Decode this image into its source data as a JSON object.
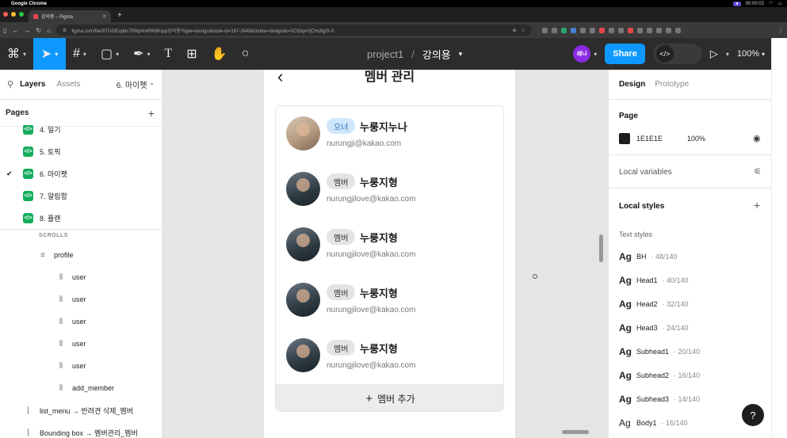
{
  "macbar": {
    "app": "Google Chrome",
    "recording_time": "00:00:02"
  },
  "browser": {
    "tab_title": "강의용 – Figma",
    "url": "figma.com/file/9TGGEup6s7P8qHmPtN8Kqq/강의용?type=design&node-id=167-2648&mode=design&t=XCtDqvVjCHs9gfX-0"
  },
  "toolbar": {
    "project": "project1",
    "separator": "/",
    "file": "강의용",
    "user_initials": "레나",
    "share_label": "Share",
    "zoom": "100%"
  },
  "left": {
    "tab_layers": "Layers",
    "tab_assets": "Assets",
    "current_page": "6. 마이펫",
    "pages_title": "Pages",
    "pages": [
      {
        "label": "4. 일기",
        "checked": false
      },
      {
        "label": "5. 토픽",
        "checked": false
      },
      {
        "label": "6. 마이펫",
        "checked": true
      },
      {
        "label": "7. 알림함",
        "checked": false
      },
      {
        "label": "8. 플랜",
        "checked": false
      }
    ],
    "scrolls_label": "SCROLLS",
    "layers": [
      {
        "label": "profile",
        "icon": "list-icon"
      },
      {
        "label": "user",
        "icon": "component-bars-icon"
      },
      {
        "label": "user",
        "icon": "component-bars-icon"
      },
      {
        "label": "user",
        "icon": "component-bars-icon"
      },
      {
        "label": "user",
        "icon": "component-bars-icon"
      },
      {
        "label": "user",
        "icon": "component-bars-icon"
      },
      {
        "label": "add_member",
        "icon": "component-bars-icon"
      },
      {
        "label": "list_menu → 반려견 삭제_멤버",
        "icon": "instance-icon"
      },
      {
        "label": "Bounding box → 멤버관리_멤버",
        "icon": "instance-icon"
      }
    ]
  },
  "canvas": {
    "title": "멤버 관리",
    "members": [
      {
        "role": "오너",
        "role_type": "owner",
        "name": "누룽지누나",
        "email": "nurungji@kakao.com"
      },
      {
        "role": "멤버",
        "role_type": "member",
        "name": "누룽지형",
        "email": "nurungjilove@kakao.com"
      },
      {
        "role": "멤버",
        "role_type": "member",
        "name": "누룽지형",
        "email": "nurungjilove@kakao.com"
      },
      {
        "role": "멤버",
        "role_type": "member",
        "name": "누룽지형",
        "email": "nurungjilove@kakao.com"
      },
      {
        "role": "멤버",
        "role_type": "member",
        "name": "누룽지형",
        "email": "nurungjilove@kakao.com"
      }
    ],
    "add_label": "멤버 추가"
  },
  "right": {
    "tab_design": "Design",
    "tab_prototype": "Prototype",
    "page_title": "Page",
    "bg_hex": "1E1E1E",
    "bg_opacity": "100%",
    "local_variables": "Local variables",
    "local_styles": "Local styles",
    "text_styles_label": "Text styles",
    "text_styles": [
      {
        "name": "BH",
        "meta": "48/140"
      },
      {
        "name": "Head1",
        "meta": "40/140"
      },
      {
        "name": "Head2",
        "meta": "32/140"
      },
      {
        "name": "Head3",
        "meta": "24/140"
      },
      {
        "name": "Subhead1",
        "meta": "20/140"
      },
      {
        "name": "Subhead2",
        "meta": "16/140"
      },
      {
        "name": "Subhead3",
        "meta": "14/140"
      },
      {
        "name": "Body1",
        "meta": "16/140"
      }
    ],
    "help": "?"
  },
  "colors": {
    "toolbar_bg": "#2c2c2c",
    "accent": "#0d99ff",
    "page_badge": "#14ae5c",
    "canvas_bg": "#e5e5e5",
    "owner_badge": "#cfe6fb",
    "member_badge": "#e4e4e4"
  }
}
